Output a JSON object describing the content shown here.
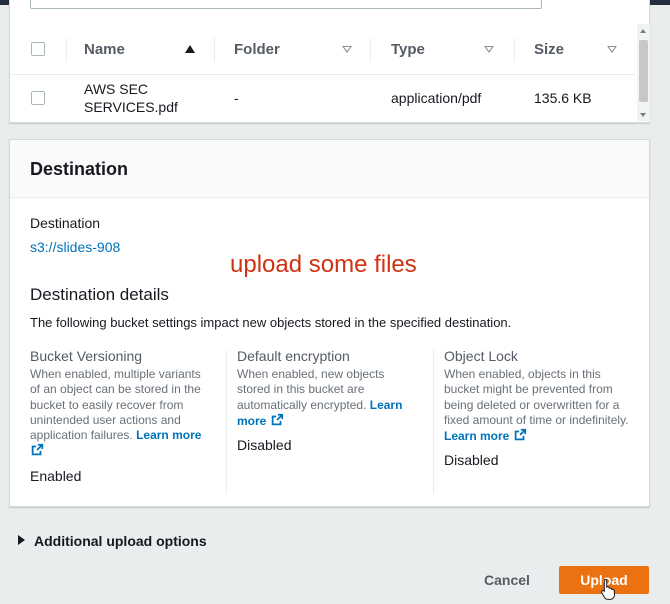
{
  "files_table": {
    "columns": [
      {
        "label": "Name",
        "sort": "ascending"
      },
      {
        "label": "Folder",
        "sort": "none"
      },
      {
        "label": "Type",
        "sort": "none"
      },
      {
        "label": "Size",
        "sort": "none"
      }
    ],
    "rows": [
      {
        "name": "AWS SEC SERVICES.pdf",
        "folder": "-",
        "type": "application/pdf",
        "size": "135.6 KB"
      }
    ]
  },
  "destination": {
    "section_title": "Destination",
    "field_label": "Destination",
    "field_value": "s3://slides-908",
    "details_title": "Destination details",
    "details_description": "The following bucket settings impact new objects stored in the specified destination.",
    "settings": [
      {
        "title": "Bucket Versioning",
        "description": "When enabled, multiple variants of an object can be stored in the bucket to easily recover from unintended user actions and application failures.",
        "learn_more": "Learn more",
        "value": "Enabled"
      },
      {
        "title": "Default encryption",
        "description": "When enabled, new objects stored in this bucket are automatically encrypted.",
        "learn_more": "Learn more",
        "value": "Disabled"
      },
      {
        "title": "Object Lock",
        "description": "When enabled, objects in this bucket might be prevented from being deleted or overwritten for a fixed amount of time or indefinitely.",
        "learn_more": "Learn more",
        "value": "Disabled"
      }
    ]
  },
  "overlay_note": "upload some files",
  "additional_options_label": "Additional upload options",
  "actions": {
    "cancel": "Cancel",
    "upload": "Upload"
  },
  "colors": {
    "accent": "#ec7211",
    "link": "#0073bb",
    "overlay_text": "#d13212"
  },
  "icons": [
    "checkbox",
    "sort-ascending-icon",
    "sort-icon",
    "external-link-icon",
    "caret-right-icon",
    "pointer-cursor-icon"
  ]
}
